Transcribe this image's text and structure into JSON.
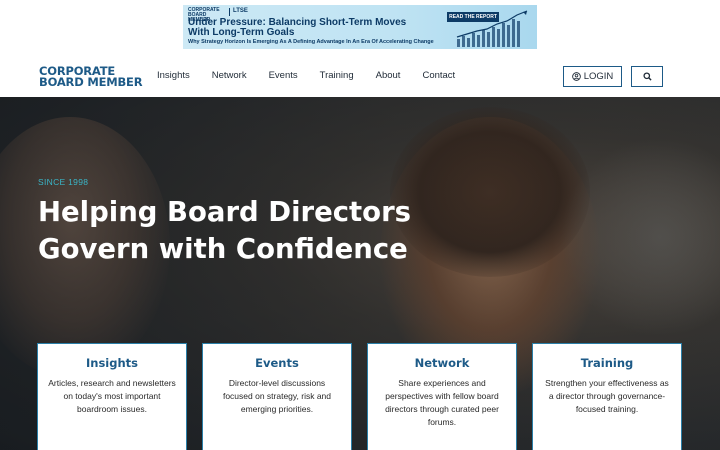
{
  "ad": {
    "logo_left": "CORPORATE BOARD MEMBER",
    "logo_right": "LTSE",
    "headline": "Under Pressure: Balancing Short-Term Moves With Long-Term Goals",
    "subline": "Why Strategy Horizon Is Emerging As A Defining Advantage In An Era Of Accelerating Change",
    "cta": "READ THE REPORT"
  },
  "header": {
    "logo_line1": "CORPORATE",
    "logo_line2": "BOARD MEMBER",
    "nav": [
      "Insights",
      "Network",
      "Events",
      "Training",
      "About",
      "Contact"
    ],
    "login_label": "LOGIN",
    "login_icon": "user-circle-icon",
    "search_icon": "search-icon"
  },
  "hero": {
    "eyebrow": "SINCE 1998",
    "title_line1": "Helping Board Directors",
    "title_line2": "Govern with Confidence"
  },
  "cards": [
    {
      "title": "Insights",
      "text": "Articles, research and newsletters on today's most important boardroom issues."
    },
    {
      "title": "Events",
      "text": "Director-level discussions focused on strategy, risk and emerging priorities."
    },
    {
      "title": "Network",
      "text": "Share experiences and perspectives with fellow board directors through curated peer forums."
    },
    {
      "title": "Training",
      "text": "Strengthen your effectiveness as a director through governance-focused training."
    }
  ],
  "colors": {
    "brand_blue": "#1d5a87",
    "accent_teal": "#3ab6c8",
    "card_border": "#2a7fa8"
  }
}
